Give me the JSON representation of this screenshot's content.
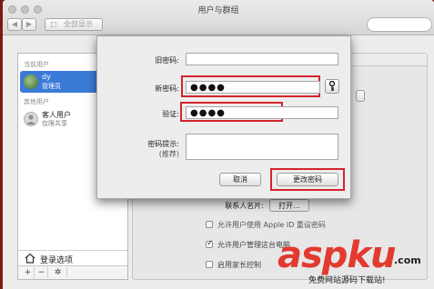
{
  "window": {
    "title": "用户与群组"
  },
  "toolbar": {
    "back_icon": "chevron-left-icon",
    "forward_icon": "chevron-right-icon",
    "show_all_label": "全部显示"
  },
  "sidebar": {
    "current_users_label": "当前用户",
    "current_user": {
      "name": "dy",
      "role": "管理员"
    },
    "other_users_label": "其他用户",
    "guest_user": {
      "name": "客人用户",
      "role": "仅限共享"
    },
    "login_options_label": "登录选项",
    "add_label": "+",
    "remove_label": "−",
    "gear_label": "✲"
  },
  "sheet": {
    "old_password_label": "旧密码:",
    "old_password_value": "",
    "new_password_label": "新密码:",
    "new_password_value": "●●●●",
    "verify_label": "验证:",
    "verify_value": "●●●●",
    "hint_label": "密码提示:",
    "hint_sublabel": "(推荐)",
    "hint_value": "",
    "cancel_label": "取消",
    "change_label": "更改密码",
    "key_icon": "key-icon"
  },
  "panel": {
    "contact_card_label": "联系人名片:",
    "open_label": "打开...",
    "options": [
      {
        "label": "允许用户使用 Apple ID 重设密码",
        "checked": false
      },
      {
        "label": "允许用户管理这台电脑",
        "checked": true
      },
      {
        "label": "启用家长控制",
        "checked": false
      }
    ]
  },
  "watermark": {
    "brand": "aspku",
    "suffix": ".com",
    "tagline": "免费网站源码下载站!"
  },
  "colors": {
    "highlight_red": "#d6242d",
    "selected_user": "#3b7bd8",
    "brand_red": "#e23a2f"
  }
}
